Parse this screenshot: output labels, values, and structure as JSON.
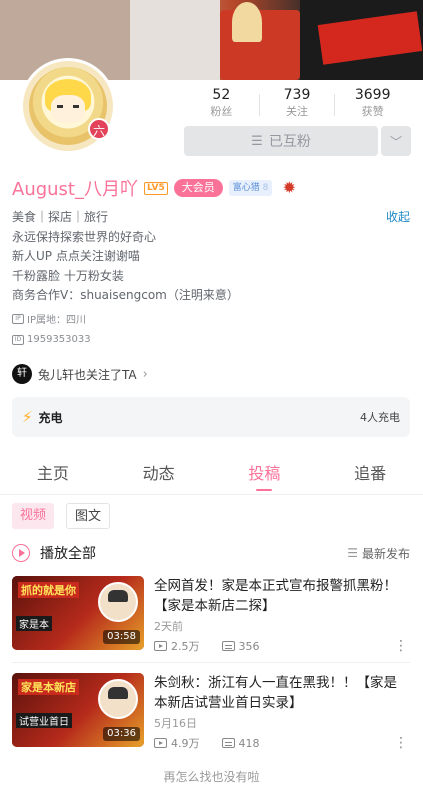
{
  "profile": {
    "username": "August_八月吖",
    "level_badge": "LV5",
    "vip_label": "大会员",
    "fans_medal": "富心猎",
    "fans_medal_level": "8",
    "avatar_badge": "六",
    "stats": [
      {
        "value": "52",
        "label": "粉丝"
      },
      {
        "value": "739",
        "label": "关注"
      },
      {
        "value": "3699",
        "label": "获赞"
      }
    ],
    "mutual_button": "已互粉",
    "bio_lines": [
      "美食｜探店｜旅行",
      "永远保持探索世界的好奇心",
      "新人UP 点点关注谢谢喵",
      "千粉露脸 十万粉女装",
      "商务合作V：shuaisengcom（注明来意）"
    ],
    "collapse_label": "收起",
    "ip_location": "IP属地：四川",
    "uid": "1959353033",
    "followed_by_text": "兔儿轩也关注了TA",
    "followed_by_avatar": "轩"
  },
  "charge": {
    "title": "充电",
    "count": "4人充电"
  },
  "tabs": [
    {
      "label": "主页",
      "active": false
    },
    {
      "label": "动态",
      "active": false
    },
    {
      "label": "投稿",
      "active": true
    },
    {
      "label": "追番",
      "active": false
    }
  ],
  "subtabs": [
    {
      "label": "视频",
      "active": true
    },
    {
      "label": "图文",
      "active": false
    }
  ],
  "list_header": {
    "play_all": "播放全部",
    "sort": "最新发布"
  },
  "videos": [
    {
      "title": "全网首发！家是本正式宣布报警抓黑粉！【家是本新店二探】",
      "date": "2天前",
      "views": "2.5万",
      "danmaku": "356",
      "duration": "03:58",
      "thumb_text_top": "抓的就是你",
      "thumb_text_mid": "家是本"
    },
    {
      "title": "朱剑秋：浙江有人一直在黑我！！【家是本新店试营业首日实录】",
      "date": "5月16日",
      "views": "4.9万",
      "danmaku": "418",
      "duration": "03:36",
      "thumb_text_top": "家是本新店",
      "thumb_text_mid": "试营业首日"
    }
  ],
  "end_text": "再怎么找也没有啦",
  "colors": {
    "accent": "#fb7299",
    "link": "#1e88c7",
    "vip": "#fb7299",
    "level": "#ff9a2a"
  }
}
